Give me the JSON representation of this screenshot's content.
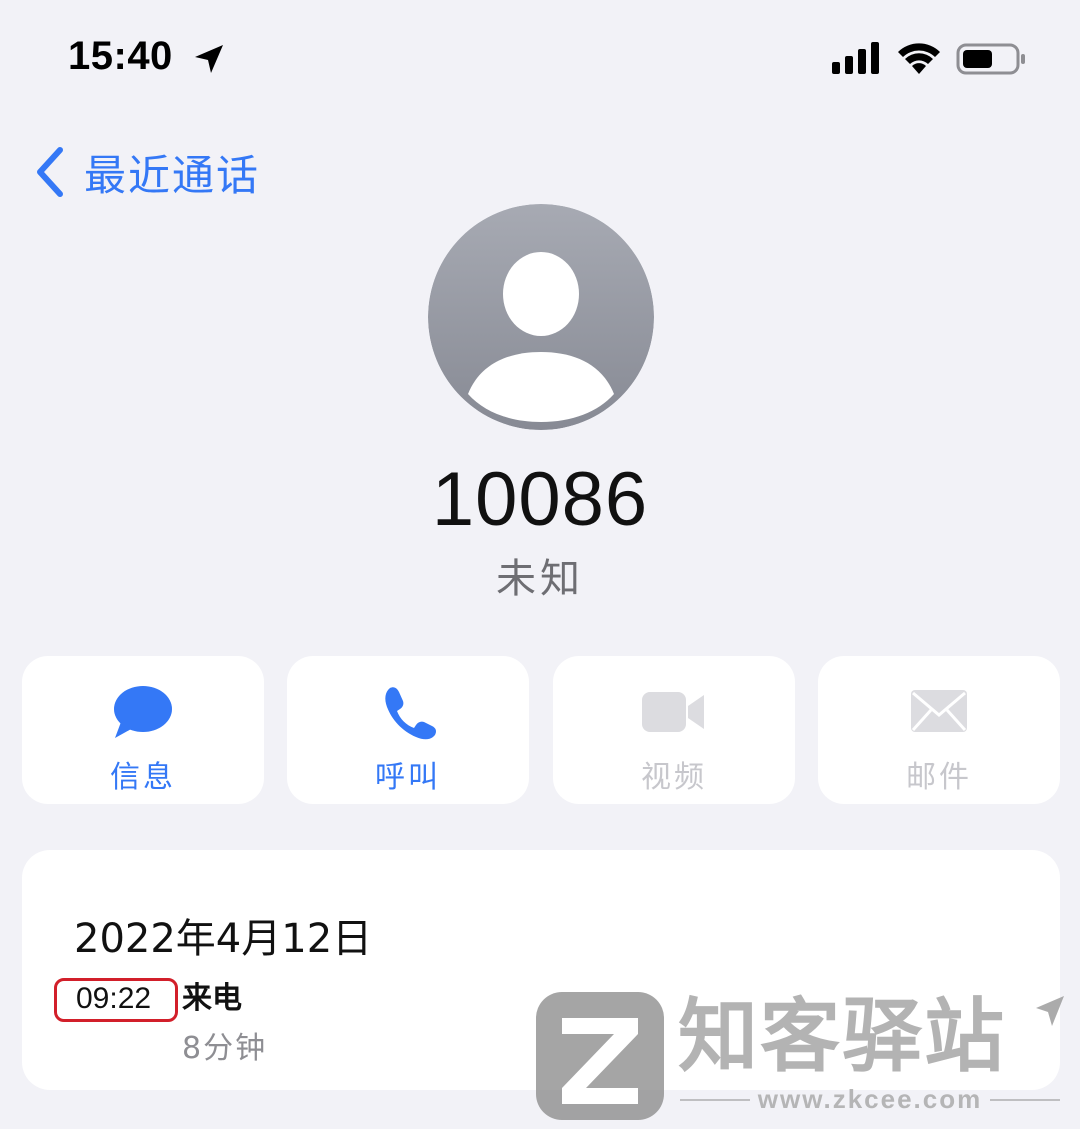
{
  "status_bar": {
    "time": "15:40",
    "icons": [
      "location-arrow-icon",
      "cellular-signal-icon",
      "wifi-icon",
      "battery-icon"
    ]
  },
  "nav": {
    "back_label": "最近通话"
  },
  "contact": {
    "number": "10086",
    "label": "未知",
    "avatar_icon": "person-silhouette-icon"
  },
  "actions": [
    {
      "label": "信息",
      "icon": "message-bubble-icon",
      "enabled": true
    },
    {
      "label": "呼叫",
      "icon": "phone-icon",
      "enabled": true
    },
    {
      "label": "视频",
      "icon": "video-camera-icon",
      "enabled": false
    },
    {
      "label": "邮件",
      "icon": "envelope-icon",
      "enabled": false
    }
  ],
  "history": {
    "date": "2022年4月12日",
    "calls": [
      {
        "time": "09:22",
        "type": "来电",
        "duration": "8分钟"
      }
    ]
  },
  "watermark": {
    "brand": "知客驿站",
    "url": "www.zkcee.com"
  },
  "colors": {
    "accent": "#3478f6",
    "background": "#f2f2f7",
    "card": "#ffffff",
    "disabled": "#c7c7cc",
    "secondary_text": "#8e8e93",
    "highlight_border": "#d21f2a"
  }
}
